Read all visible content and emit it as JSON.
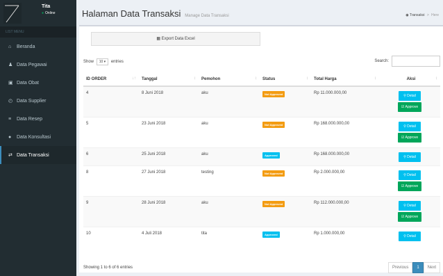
{
  "user": {
    "name": "Tita",
    "status": "Online"
  },
  "menu_header": "LIST MENU",
  "sidebar": {
    "items": [
      {
        "label": "Beranda",
        "icon": "home-icon"
      },
      {
        "label": "Data Pegawai",
        "icon": "user-icon"
      },
      {
        "label": "Data Obat",
        "icon": "medkit-icon"
      },
      {
        "label": "Data Supplier",
        "icon": "clock-icon"
      },
      {
        "label": "Data Resep",
        "icon": "list-icon"
      },
      {
        "label": "Data Konsultasi",
        "icon": "chat-icon"
      },
      {
        "label": "Data Transaksi",
        "icon": "exchange-icon"
      }
    ]
  },
  "header": {
    "title": "Halaman Data Transaksi",
    "subtitle": "Manage Data Transaksi"
  },
  "breadcrumb": {
    "section": "Transaksi",
    "current": "Here"
  },
  "export_label": "Export Data Excel",
  "length": {
    "show": "Show",
    "value": "10",
    "entries": "entries"
  },
  "search": {
    "label": "Search:",
    "value": ""
  },
  "table": {
    "headers": [
      "ID ORDER",
      "Tanggal",
      "Pemohon",
      "Status",
      "Total Harga",
      "Aksi"
    ],
    "rows": [
      {
        "id": "4",
        "tanggal": "8 Juni 2018",
        "pemohon": "aku",
        "status": "Not Approved",
        "total": "Rp 11.000.000,00",
        "approve": true
      },
      {
        "id": "5",
        "tanggal": "23 Juni 2018",
        "pemohon": "aku",
        "status": "Not Approved",
        "total": "Rp 168.000.000,00",
        "approve": true
      },
      {
        "id": "6",
        "tanggal": "25 Juni 2018",
        "pemohon": "aku",
        "status": "Approved",
        "total": "Rp 168.000.000,00",
        "approve": false
      },
      {
        "id": "8",
        "tanggal": "27 Juni 2018",
        "pemohon": "testing",
        "status": "Not Approved",
        "total": "Rp 2.000.000,00",
        "approve": true
      },
      {
        "id": "9",
        "tanggal": "28 Juni 2018",
        "pemohon": "aku",
        "status": "Not Approved",
        "total": "Rp 112.000.000,00",
        "approve": true
      },
      {
        "id": "10",
        "tanggal": "4 Juli 2018",
        "pemohon": "tita",
        "status": "Approved",
        "total": "Rp 1.000.000,00",
        "approve": false
      }
    ],
    "detail_label": "Detail",
    "approve_label": "Approve"
  },
  "info": "Showing 1 to 6 of 6 entries",
  "pager": {
    "prev": "Previous",
    "page": "1",
    "next": "Next"
  },
  "colors": {
    "sidebar": "#222d32",
    "primary": "#3c8dbc",
    "info": "#00c0ef",
    "success": "#00a65a",
    "warning": "#f39c12"
  }
}
